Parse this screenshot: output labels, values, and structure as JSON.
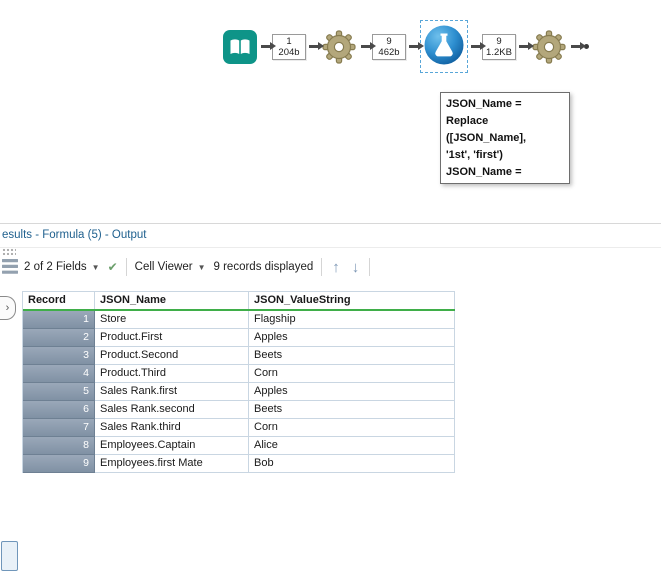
{
  "colors": {
    "accent_blue": "#58a6d8",
    "title_blue": "#20618f",
    "header_green": "#3fae49",
    "record_cell_bg": "#8091a4",
    "tool_teal": "#0e9488",
    "tool_gear": "#b3a77b",
    "tool_formula_blue": "#2e8fd0"
  },
  "workflow": {
    "annotations": [
      {
        "count": "1",
        "size": "204b"
      },
      {
        "count": "9",
        "size": "462b"
      },
      {
        "count": "9",
        "size": "1.2KB"
      }
    ],
    "tooltip": {
      "lines": [
        "JSON_Name =",
        "Replace",
        "([JSON_Name],",
        "'1st', 'first')",
        "JSON_Name ="
      ]
    }
  },
  "results": {
    "title": "esults - Formula (5) - Output",
    "toolbar": {
      "fields": "2 of 2 Fields",
      "cell_viewer": "Cell Viewer",
      "records": "9 records displayed"
    },
    "table": {
      "columns": [
        "Record",
        "JSON_Name",
        "JSON_ValueString"
      ],
      "rows": [
        {
          "record": "1",
          "json_name": "Store",
          "json_value": "Flagship"
        },
        {
          "record": "2",
          "json_name": "Product.First",
          "json_value": "Apples"
        },
        {
          "record": "3",
          "json_name": "Product.Second",
          "json_value": "Beets"
        },
        {
          "record": "4",
          "json_name": "Product.Third",
          "json_value": "Corn"
        },
        {
          "record": "5",
          "json_name": "Sales Rank.first",
          "json_value": "Apples"
        },
        {
          "record": "6",
          "json_name": "Sales Rank.second",
          "json_value": "Beets"
        },
        {
          "record": "7",
          "json_name": "Sales Rank.third",
          "json_value": "Corn"
        },
        {
          "record": "8",
          "json_name": "Employees.Captain",
          "json_value": "Alice"
        },
        {
          "record": "9",
          "json_name": "Employees.first Mate",
          "json_value": "Bob"
        }
      ]
    }
  },
  "icons": {
    "dropdown_caret": "▼",
    "check": "✔",
    "up_arrow": "↑",
    "down_arrow": "↓",
    "popout_glyph": "›"
  }
}
